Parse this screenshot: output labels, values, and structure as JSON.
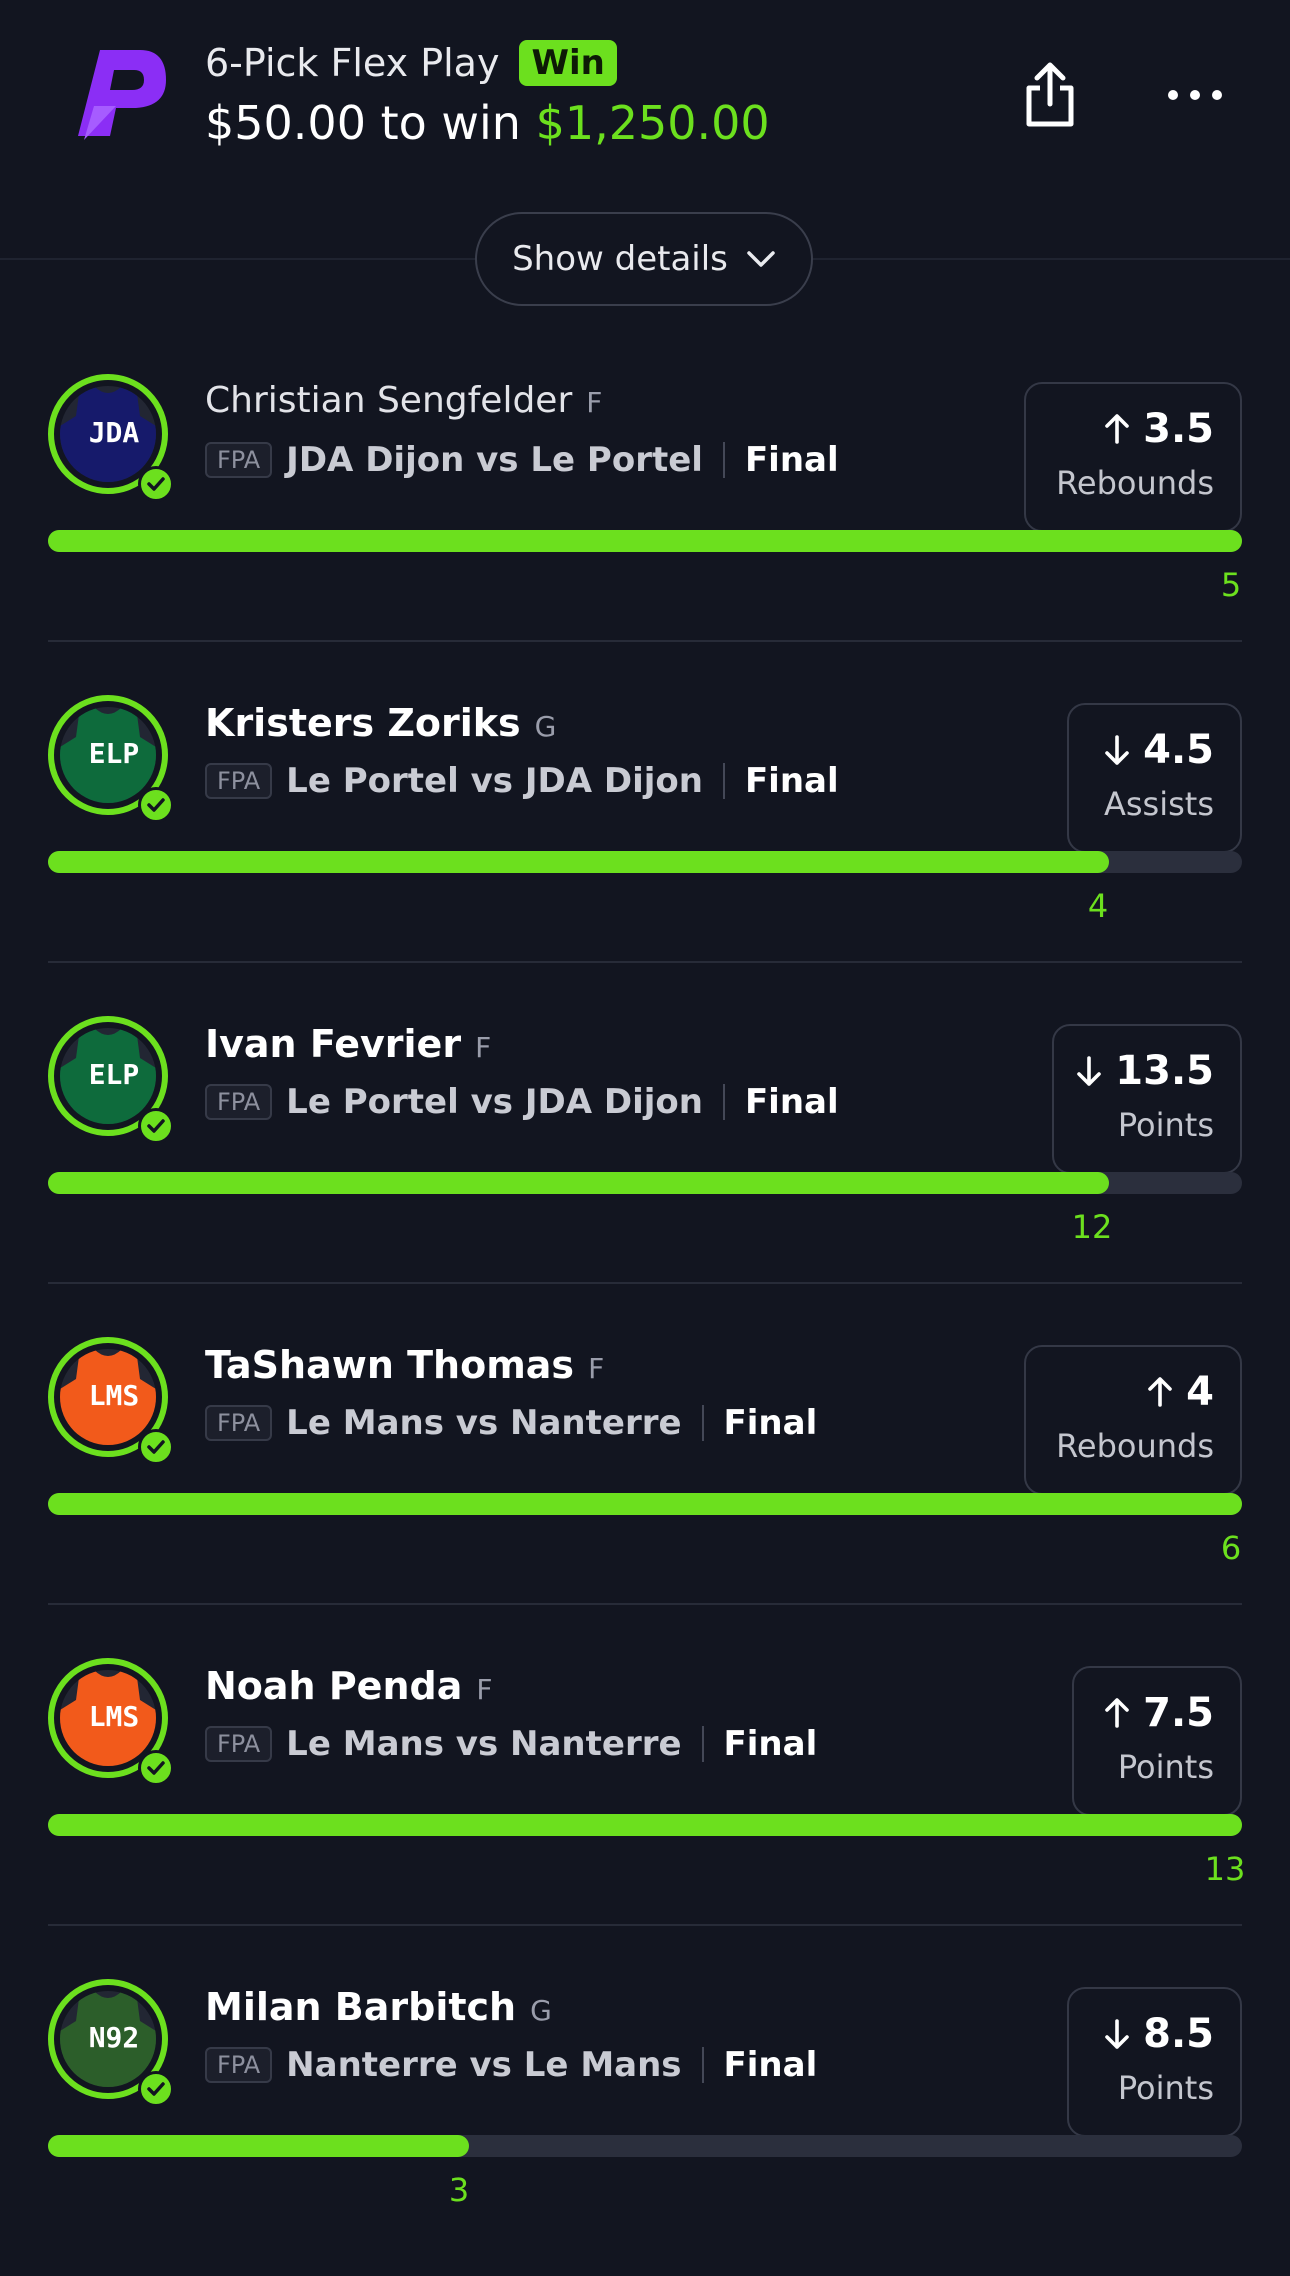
{
  "header": {
    "title": "6-Pick Flex Play",
    "badge": "Win",
    "entry": "$50.00",
    "to_win_label": "to win",
    "payout": "$1,250.00"
  },
  "details_button": {
    "label": "Show details"
  },
  "colors": {
    "accent": "#6ce01e",
    "background": "#121520",
    "logo": "#8b2ef5"
  },
  "picks": [
    {
      "name": "Christian Sengfelder",
      "position": "F",
      "team_abbr": "JDA",
      "jersey_color": "#161a6b",
      "league": "FPA",
      "matchup": "JDA Dijon vs Le Portel",
      "status": "Final",
      "direction": "up",
      "line": "3.5",
      "stat": "Rebounds",
      "actual": "5",
      "progress": 1.0
    },
    {
      "name": "Kristers Zoriks",
      "position": "G",
      "team_abbr": "ELP",
      "jersey_color": "#0e6b3c",
      "league": "FPA",
      "matchup": "Le Portel vs JDA Dijon",
      "status": "Final",
      "direction": "down",
      "line": "4.5",
      "stat": "Assists",
      "actual": "4",
      "progress": 0.889
    },
    {
      "name": "Ivan Fevrier",
      "position": "F",
      "team_abbr": "ELP",
      "jersey_color": "#0e6b3c",
      "league": "FPA",
      "matchup": "Le Portel vs JDA Dijon",
      "status": "Final",
      "direction": "down",
      "line": "13.5",
      "stat": "Points",
      "actual": "12",
      "progress": 0.889
    },
    {
      "name": "TaShawn Thomas",
      "position": "F",
      "team_abbr": "LMS",
      "jersey_color": "#f25a1b",
      "league": "FPA",
      "matchup": "Le Mans vs Nanterre",
      "status": "Final",
      "direction": "up",
      "line": "4",
      "stat": "Rebounds",
      "actual": "6",
      "progress": 1.0
    },
    {
      "name": "Noah Penda",
      "position": "F",
      "team_abbr": "LMS",
      "jersey_color": "#f25a1b",
      "league": "FPA",
      "matchup": "Le Mans vs Nanterre",
      "status": "Final",
      "direction": "up",
      "line": "7.5",
      "stat": "Points",
      "actual": "13",
      "progress": 1.0
    },
    {
      "name": "Milan Barbitch",
      "position": "G",
      "team_abbr": "N92",
      "jersey_color": "#2c5e2a",
      "league": "FPA",
      "matchup": "Nanterre vs Le Mans",
      "status": "Final",
      "direction": "down",
      "line": "8.5",
      "stat": "Points",
      "actual": "3",
      "progress": 0.353
    }
  ]
}
